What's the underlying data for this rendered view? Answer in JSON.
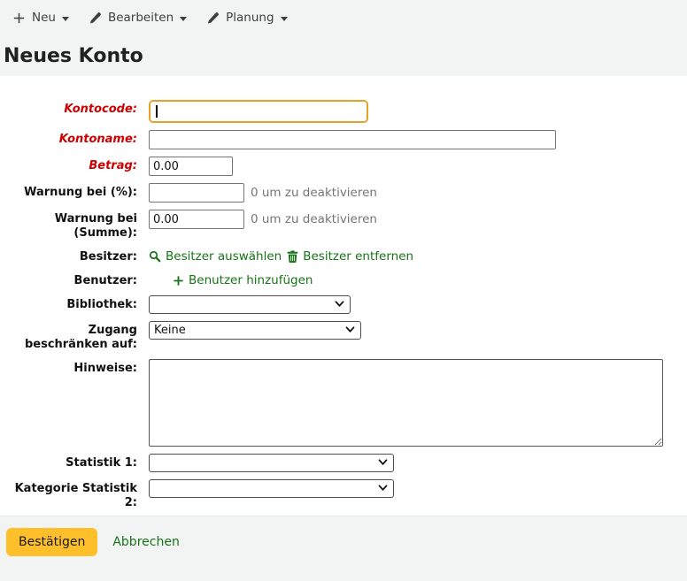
{
  "toolbar": {
    "new_label": "Neu",
    "edit_label": "Bearbeiten",
    "planning_label": "Planung"
  },
  "page": {
    "title": "Neues Konto"
  },
  "form": {
    "labels": {
      "kontocode": "Kontocode:",
      "kontoname": "Kontoname:",
      "betrag": "Betrag:",
      "warnung_prozent": "Warnung bei (%):",
      "warnung_summe": "Warnung bei (Summe):",
      "besitzer": "Besitzer:",
      "benutzer": "Benutzer:",
      "bibliothek": "Bibliothek:",
      "zugang": "Zugang beschränken auf:",
      "hinweise": "Hinweise:",
      "statistik1": "Statistik 1:",
      "statistik2": "Kategorie Statistik 2:"
    },
    "values": {
      "kontocode": "",
      "kontoname": "",
      "betrag": "0.00",
      "warnung_prozent": "",
      "warnung_summe": "0.00",
      "bibliothek": "",
      "zugang": "Keine",
      "hinweise": "",
      "statistik1": "",
      "statistik2": ""
    },
    "hints": {
      "warnung_prozent": "0 um zu deaktivieren",
      "warnung_summe": "0 um zu deaktivieren"
    },
    "links": {
      "select_owner": "Besitzer auswählen",
      "remove_owner": "Besitzer entfernen",
      "add_user": "Benutzer hinzufügen"
    }
  },
  "footer": {
    "submit_label": "Bestätigen",
    "cancel_label": "Abbrechen"
  },
  "icons": {
    "new": "plus-icon",
    "edit": "pencil-icon",
    "planning": "pencil-icon",
    "select_owner": "search-icon",
    "remove_owner": "trash-icon",
    "add_user": "plus-icon"
  },
  "colors": {
    "required_red": "#CC0000",
    "link_green": "#177317",
    "submit_yellow": "#FDC02B",
    "focus_orange": "#E6A12B",
    "page_bg": "#F2F4F4"
  }
}
